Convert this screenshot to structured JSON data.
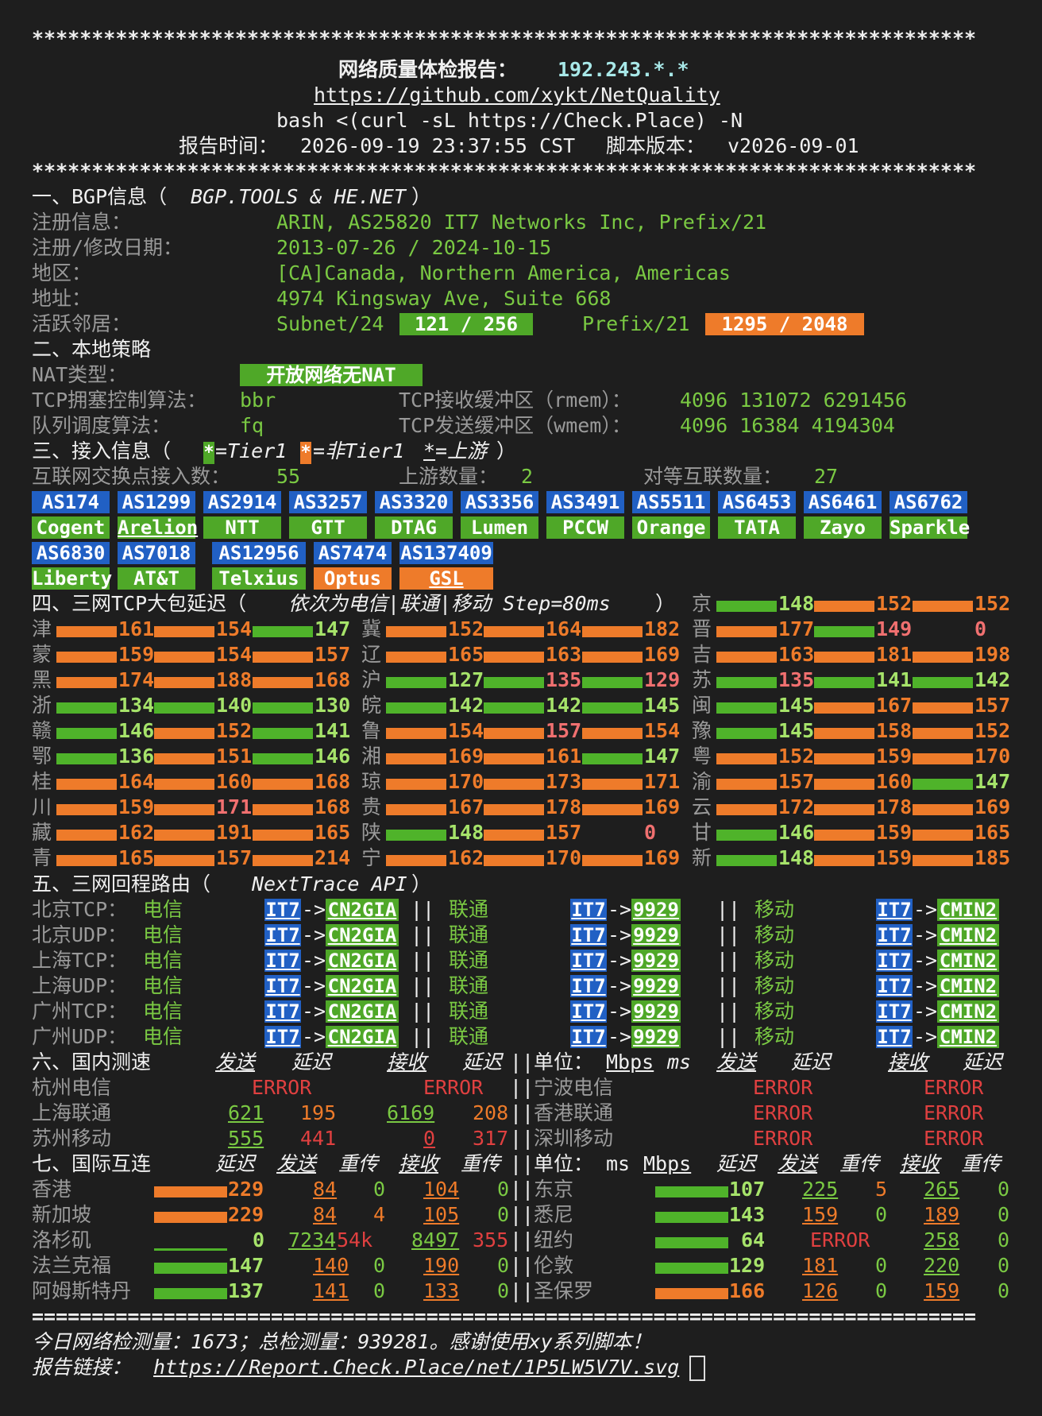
{
  "stars": "*******************************************************************************",
  "eqline": "===============================================================================",
  "header": {
    "title_cn": "网络质量体检报告：",
    "ip": "192.243.*.*",
    "url": "https://github.com/xykt/NetQuality",
    "cmd": "bash <(curl -sL https://Check.Place) -N",
    "time_label": "报告时间：",
    "time": "2026-09-19 23:37:55 CST",
    "ver_label": "脚本版本：",
    "ver": "v2026-09-01"
  },
  "s1": {
    "title": "一、BGP信息（",
    "src": "BGP.TOOLS & HE.NET",
    "end": "）",
    "reg_l": "注册信息：",
    "reg": "ARIN, AS25820 IT7 Networks Inc, Prefix/21",
    "date_l": "注册/修改日期：",
    "date": "2013-07-26 / 2024-10-15",
    "area_l": "地区：",
    "area": "[CA]Canada, Northern America, Americas",
    "addr_l": "地址：",
    "addr": "4974 Kingsway Ave, Suite 668",
    "nb_l": "活跃邻居：",
    "sub_l": "Subnet/24",
    "sub": "121 / 256",
    "pre_l": "Prefix/21",
    "pre": "1295 / 2048"
  },
  "s2": {
    "title": "二、本地策略",
    "nat_l": "NAT类型：",
    "nat": "开放网络无NAT",
    "tcp_l": "TCP拥塞控制算法：",
    "tcp": "bbr",
    "rmem_l": "TCP接收缓冲区（rmem）：",
    "rmem": "4096 131072 6291456",
    "q_l": "队列调度算法：",
    "q": "fq",
    "wmem_l": "TCP发送缓冲区（wmem）：",
    "wmem": "4096 16384 4194304"
  },
  "s3": {
    "title": "三、接入信息（",
    "star": "*",
    "t1": "=Tier1 ",
    "t2": "=非Tier1 ",
    "t3": "=上游",
    "end": "）",
    "ix_l": "互联网交换点接入数：",
    "ix": "55",
    "up_l": "上游数量：",
    "up": "2",
    "peer_l": "对等互联数量：",
    "peer": "27",
    "as1": [
      [
        "AS174",
        "Cogent"
      ],
      [
        "AS1299",
        "Arelion"
      ],
      [
        "AS2914",
        "NTT"
      ],
      [
        "AS3257",
        "GTT"
      ],
      [
        "AS3320",
        "DTAG"
      ],
      [
        "AS3356",
        "Lumen"
      ],
      [
        "AS3491",
        "PCCW"
      ],
      [
        "AS5511",
        "Orange"
      ],
      [
        "AS6453",
        "TATA"
      ],
      [
        "AS6461",
        "Zayo"
      ],
      [
        "AS6762",
        "Sparkle"
      ]
    ],
    "as2": [
      [
        "AS6830",
        "Liberty"
      ],
      [
        "AS7018",
        "AT&T"
      ],
      [
        "AS12956",
        "Telxius"
      ],
      [
        "AS7474",
        "Optus"
      ],
      [
        "AS137409",
        "GSL"
      ]
    ]
  },
  "s4": {
    "title": "四、三网TCP大包延迟（",
    "sub": "依次为电信|联通|移动 Step=80ms",
    "end": "）",
    "rows": [
      [
        [
          "京",
          "148",
          "152",
          "152"
        ]
      ],
      [
        [
          "津",
          "161",
          "154",
          "147"
        ],
        [
          "冀",
          "152",
          "164",
          "182"
        ],
        [
          "晋",
          "177",
          "149",
          "0"
        ]
      ],
      [
        [
          "蒙",
          "159",
          "154",
          "157"
        ],
        [
          "辽",
          "165",
          "163",
          "169"
        ],
        [
          "吉",
          "163",
          "181",
          "198"
        ]
      ],
      [
        [
          "黑",
          "174",
          "188",
          "168"
        ],
        [
          "沪",
          "127",
          "135",
          "129"
        ],
        [
          "苏",
          "135",
          "141",
          "142"
        ]
      ],
      [
        [
          "浙",
          "134",
          "140",
          "130"
        ],
        [
          "皖",
          "142",
          "142",
          "145"
        ],
        [
          "闽",
          "145",
          "167",
          "157"
        ]
      ],
      [
        [
          "赣",
          "146",
          "152",
          "141"
        ],
        [
          "鲁",
          "154",
          "157",
          "154"
        ],
        [
          "豫",
          "145",
          "158",
          "152"
        ]
      ],
      [
        [
          "鄂",
          "136",
          "151",
          "146"
        ],
        [
          "湘",
          "169",
          "161",
          "147"
        ],
        [
          "粤",
          "152",
          "159",
          "170"
        ]
      ],
      [
        [
          "桂",
          "164",
          "160",
          "168"
        ],
        [
          "琼",
          "170",
          "173",
          "171"
        ],
        [
          "渝",
          "157",
          "160",
          "147"
        ]
      ],
      [
        [
          "川",
          "159",
          "171",
          "168"
        ],
        [
          "贵",
          "167",
          "178",
          "169"
        ],
        [
          "云",
          "172",
          "178",
          "169"
        ]
      ],
      [
        [
          "藏",
          "162",
          "191",
          "165"
        ],
        [
          "陕",
          "148",
          "157",
          "0"
        ],
        [
          "甘",
          "146",
          "159",
          "165"
        ]
      ],
      [
        [
          "青",
          "165",
          "157",
          "214"
        ],
        [
          "宁",
          "162",
          "170",
          "169"
        ],
        [
          "新",
          "148",
          "159",
          "185"
        ]
      ]
    ]
  },
  "s5": {
    "title": "五、三网回程路由（",
    "src": "NextTrace API",
    "end": "）",
    "rows": [
      "北京TCP：",
      "北京UDP：",
      "上海TCP：",
      "上海UDP：",
      "广州TCP：",
      "广州UDP："
    ],
    "ct": "电信",
    "cu": "联通",
    "cm": "移动",
    "it7": "IT7",
    "arrow": "->",
    "ct_r": "CN2GIA",
    "cu_r": "9929",
    "cm_r": "CMIN2",
    "sep": "||"
  },
  "s6": {
    "title": "六、国内测速",
    "h": [
      "发送",
      "延迟",
      "接收",
      "延迟"
    ],
    "sep": "||",
    "unit": "单位：",
    "mbps": "Mbps",
    "ms": "ms",
    "l": [
      [
        "杭州电信",
        "ERROR",
        "",
        "ERROR",
        ""
      ],
      [
        "上海联通",
        "621",
        "195",
        "6169",
        "208"
      ],
      [
        "苏州移动",
        "555",
        "441",
        "0",
        "317"
      ]
    ],
    "r": [
      [
        "宁波电信",
        "ERROR",
        "",
        "ERROR",
        ""
      ],
      [
        "香港联通",
        "ERROR",
        "",
        "ERROR",
        ""
      ],
      [
        "深圳移动",
        "ERROR",
        "",
        "ERROR",
        ""
      ]
    ]
  },
  "s7": {
    "title": "七、国际互连",
    "h": [
      "延迟",
      "发送",
      "重传",
      "接收",
      "重传"
    ],
    "unit": "单位：",
    "ms": "ms",
    "mbps": "Mbps",
    "l": [
      [
        "香港",
        "229",
        "84",
        "0",
        "104",
        "0"
      ],
      [
        "新加坡",
        "229",
        "84",
        "4",
        "105",
        "0"
      ],
      [
        "洛杉矶",
        "0",
        "7234",
        "54k",
        "8497",
        "355"
      ],
      [
        "法兰克福",
        "147",
        "140",
        "0",
        "190",
        "0"
      ],
      [
        "阿姆斯特丹",
        "137",
        "141",
        "0",
        "133",
        "0"
      ]
    ],
    "r": [
      [
        "东京",
        "107",
        "225",
        "5",
        "265",
        "0"
      ],
      [
        "悉尼",
        "143",
        "159",
        "0",
        "189",
        "0"
      ],
      [
        "纽约",
        "64",
        "ERROR",
        "",
        "258",
        "0"
      ],
      [
        "伦敦",
        "129",
        "181",
        "0",
        "220",
        "0"
      ],
      [
        "圣保罗",
        "166",
        "126",
        "0",
        "159",
        "0"
      ]
    ]
  },
  "footer": {
    "l1": "今日网络检测量：1673；总检测量：939281。感谢使用xy系列脚本！",
    "l2_l": "报告链接：",
    "l2": "https://Report.Check.Place/net/1P5LW5V7V.svg"
  }
}
